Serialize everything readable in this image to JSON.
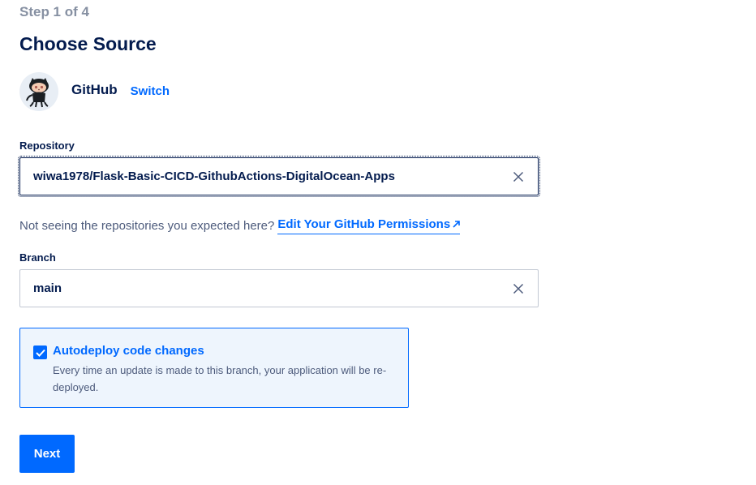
{
  "header": {
    "step": "Step 1 of 4",
    "title": "Choose Source"
  },
  "source": {
    "provider": "GitHub",
    "switch_label": "Switch",
    "avatar_icon": "octocat-icon"
  },
  "repository": {
    "label": "Repository",
    "value": "wiwa1978/Flask-Basic-CICD-GithubActions-DigitalOcean-Apps"
  },
  "hint": {
    "text": "Not seeing the repositories you expected here?",
    "link_label": "Edit Your GitHub Permissions"
  },
  "branch": {
    "label": "Branch",
    "value": "main"
  },
  "autodeploy": {
    "checked": true,
    "label": "Autodeploy code changes",
    "description": "Every time an update is made to this branch, your application will be re-deployed."
  },
  "actions": {
    "next_label": "Next"
  },
  "colors": {
    "accent": "#0069ff",
    "heading": "#031b4e",
    "muted": "#8690a2",
    "panel_bg": "#eef5fd"
  }
}
